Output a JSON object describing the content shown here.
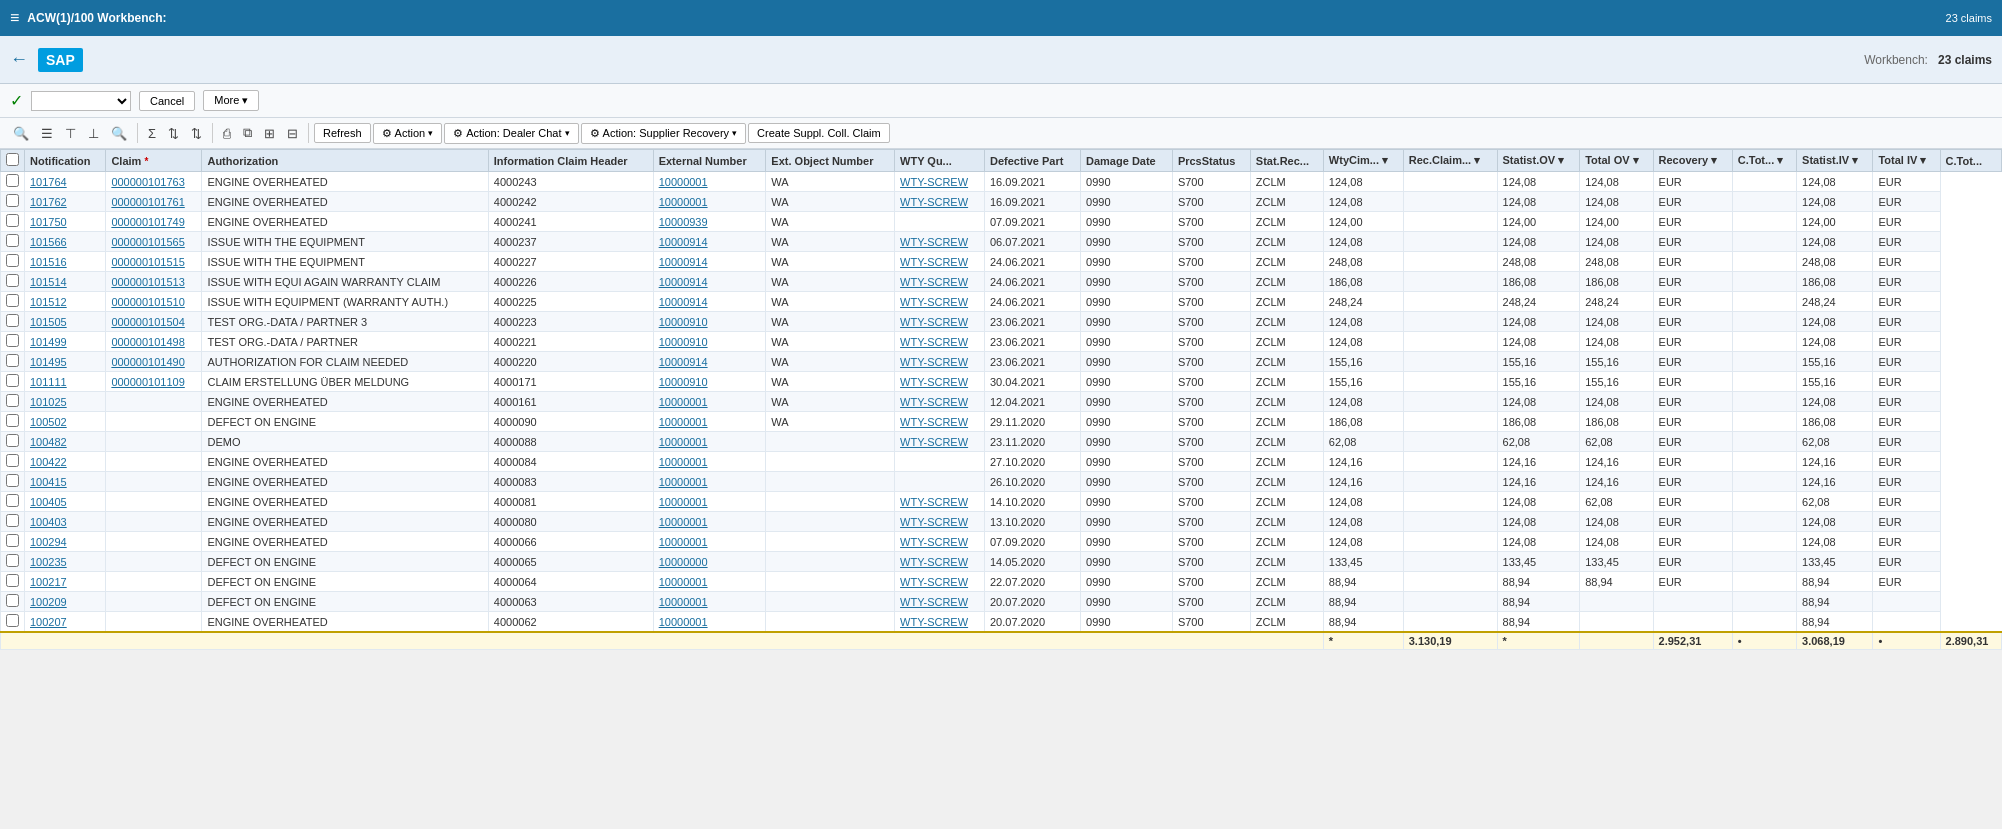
{
  "topbar": {
    "menu_icon": "≡",
    "title": "ACW(1)/100 Workbench:",
    "claims_label": "23 claims"
  },
  "header": {
    "back_label": "←",
    "logo_text": "SAP",
    "workbench_label": "Workbench:",
    "claims_count": "23 claims"
  },
  "actionbar": {
    "check_icon": "✓",
    "cancel_label": "Cancel",
    "more_label": "More ▾"
  },
  "toolbar": {
    "search_icon": "🔍",
    "filter_icons": [
      "☰",
      "⊤",
      "⊥"
    ],
    "sum_icon": "Σ",
    "sort_icon": "⇅",
    "print_icon": "⎙",
    "copy_icon": "⧉",
    "export_icon": "⊞",
    "refresh_label": "Refresh",
    "action_label": "Action",
    "action_dealer_label": "Action: Dealer Chat",
    "action_supplier_label": "Action: Supplier Recovery",
    "create_label": "Create Suppl. Coll. Claim"
  },
  "table": {
    "columns": [
      "",
      "Notification",
      "Claim",
      "Authorization",
      "Information Claim Header",
      "External Number",
      "Ext. Object Number",
      "WTY Qu...",
      "Defective Part",
      "Damage Date",
      "PrcsStatus",
      "Stat.Rec...",
      "WtyCim... ▾",
      "Rec.Claim... ▾",
      "Statist.OV ▾",
      "Total OV ▾",
      "Recovery ▾",
      "C.Tot... ▾",
      "Statist.IV ▾",
      "Total IV ▾",
      "C.Tot..."
    ],
    "rows": [
      [
        "",
        "101764",
        "000000101763",
        "ENGINE OVERHEATED",
        "4000243",
        "10000001",
        "WA",
        "WTY-SCREW",
        "16.09.2021",
        "0990",
        "S700",
        "ZCLM",
        "124,08",
        "",
        "124,08",
        "124,08",
        "EUR",
        "",
        "124,08",
        "EUR"
      ],
      [
        "",
        "101762",
        "000000101761",
        "ENGINE OVERHEATED",
        "4000242",
        "10000001",
        "WA",
        "WTY-SCREW",
        "16.09.2021",
        "0990",
        "S700",
        "ZCLM",
        "124,08",
        "",
        "124,08",
        "124,08",
        "EUR",
        "",
        "124,08",
        "EUR"
      ],
      [
        "",
        "101750",
        "000000101749",
        "ENGINE OVERHEATED",
        "4000241",
        "10000939",
        "WA",
        "",
        "07.09.2021",
        "0990",
        "S700",
        "ZCLM",
        "124,00",
        "",
        "124,00",
        "124,00",
        "EUR",
        "",
        "124,00",
        "EUR"
      ],
      [
        "",
        "101566",
        "000000101565",
        "ISSUE WITH THE EQUIPMENT",
        "4000237",
        "10000914",
        "WA",
        "WTY-SCREW",
        "06.07.2021",
        "0990",
        "S700",
        "ZCLM",
        "124,08",
        "",
        "124,08",
        "124,08",
        "EUR",
        "",
        "124,08",
        "EUR"
      ],
      [
        "",
        "101516",
        "000000101515",
        "ISSUE WITH THE EQUIPMENT",
        "4000227",
        "10000914",
        "WA",
        "WTY-SCREW",
        "24.06.2021",
        "0990",
        "S700",
        "ZCLM",
        "248,08",
        "",
        "248,08",
        "248,08",
        "EUR",
        "",
        "248,08",
        "EUR"
      ],
      [
        "",
        "101514",
        "000000101513",
        "ISSUE WITH EQUI AGAIN WARRANTY CLAIM",
        "4000226",
        "10000914",
        "WA",
        "WTY-SCREW",
        "24.06.2021",
        "0990",
        "S700",
        "ZCLM",
        "186,08",
        "",
        "186,08",
        "186,08",
        "EUR",
        "",
        "186,08",
        "EUR"
      ],
      [
        "",
        "101512",
        "000000101510",
        "ISSUE WITH EQUIPMENT (WARRANTY AUTH.)",
        "4000225",
        "10000914",
        "WA",
        "WTY-SCREW",
        "24.06.2021",
        "0990",
        "S700",
        "ZCLM",
        "248,24",
        "",
        "248,24",
        "248,24",
        "EUR",
        "",
        "248,24",
        "EUR"
      ],
      [
        "",
        "101505",
        "000000101504",
        "TEST ORG.-DATA / PARTNER 3",
        "4000223",
        "10000910",
        "WA",
        "WTY-SCREW",
        "23.06.2021",
        "0990",
        "S700",
        "ZCLM",
        "124,08",
        "",
        "124,08",
        "124,08",
        "EUR",
        "",
        "124,08",
        "EUR"
      ],
      [
        "",
        "101499",
        "000000101498",
        "TEST ORG.-DATA / PARTNER",
        "4000221",
        "10000910",
        "WA",
        "WTY-SCREW",
        "23.06.2021",
        "0990",
        "S700",
        "ZCLM",
        "124,08",
        "",
        "124,08",
        "124,08",
        "EUR",
        "",
        "124,08",
        "EUR"
      ],
      [
        "",
        "101495",
        "000000101490",
        "AUTHORIZATION FOR CLAIM NEEDED",
        "4000220",
        "10000914",
        "WA",
        "WTY-SCREW",
        "23.06.2021",
        "0990",
        "S700",
        "ZCLM",
        "155,16",
        "",
        "155,16",
        "155,16",
        "EUR",
        "",
        "155,16",
        "EUR"
      ],
      [
        "",
        "101111",
        "000000101109",
        "CLAIM ERSTELLUNG ÜBER MELDUNG",
        "4000171",
        "10000910",
        "WA",
        "WTY-SCREW",
        "30.04.2021",
        "0990",
        "S700",
        "ZCLM",
        "155,16",
        "",
        "155,16",
        "155,16",
        "EUR",
        "",
        "155,16",
        "EUR"
      ],
      [
        "",
        "101025",
        "",
        "ENGINE OVERHEATED",
        "4000161",
        "10000001",
        "WA",
        "WTY-SCREW",
        "12.04.2021",
        "0990",
        "S700",
        "ZCLM",
        "124,08",
        "",
        "124,08",
        "124,08",
        "EUR",
        "",
        "124,08",
        "EUR"
      ],
      [
        "",
        "100502",
        "",
        "DEFECT ON ENGINE",
        "4000090",
        "10000001",
        "WA",
        "WTY-SCREW",
        "29.11.2020",
        "0990",
        "S700",
        "ZCLM",
        "186,08",
        "",
        "186,08",
        "186,08",
        "EUR",
        "",
        "186,08",
        "EUR"
      ],
      [
        "",
        "100482",
        "",
        "DEMO",
        "4000088",
        "10000001",
        "",
        "WTY-SCREW",
        "23.11.2020",
        "0990",
        "S700",
        "ZCLM",
        "62,08",
        "",
        "62,08",
        "62,08",
        "EUR",
        "",
        "62,08",
        "EUR"
      ],
      [
        "",
        "100422",
        "",
        "ENGINE OVERHEATED",
        "4000084",
        "10000001",
        "",
        "",
        "27.10.2020",
        "0990",
        "S700",
        "ZCLM",
        "124,16",
        "",
        "124,16",
        "124,16",
        "EUR",
        "",
        "124,16",
        "EUR"
      ],
      [
        "",
        "100415",
        "",
        "ENGINE OVERHEATED",
        "4000083",
        "10000001",
        "",
        "",
        "26.10.2020",
        "0990",
        "S700",
        "ZCLM",
        "124,16",
        "",
        "124,16",
        "124,16",
        "EUR",
        "",
        "124,16",
        "EUR"
      ],
      [
        "",
        "100405",
        "",
        "ENGINE OVERHEATED",
        "4000081",
        "10000001",
        "",
        "WTY-SCREW",
        "14.10.2020",
        "0990",
        "S700",
        "ZCLM",
        "124,08",
        "",
        "124,08",
        "62,08",
        "EUR",
        "",
        "62,08",
        "EUR"
      ],
      [
        "",
        "100403",
        "",
        "ENGINE OVERHEATED",
        "4000080",
        "10000001",
        "",
        "WTY-SCREW",
        "13.10.2020",
        "0990",
        "S700",
        "ZCLM",
        "124,08",
        "",
        "124,08",
        "124,08",
        "EUR",
        "",
        "124,08",
        "EUR"
      ],
      [
        "",
        "100294",
        "",
        "ENGINE OVERHEATED",
        "4000066",
        "10000001",
        "",
        "WTY-SCREW",
        "07.09.2020",
        "0990",
        "S700",
        "ZCLM",
        "124,08",
        "",
        "124,08",
        "124,08",
        "EUR",
        "",
        "124,08",
        "EUR"
      ],
      [
        "",
        "100235",
        "",
        "DEFECT ON ENGINE",
        "4000065",
        "10000000",
        "",
        "WTY-SCREW",
        "14.05.2020",
        "0990",
        "S700",
        "ZCLM",
        "133,45",
        "",
        "133,45",
        "133,45",
        "EUR",
        "",
        "133,45",
        "EUR"
      ],
      [
        "",
        "100217",
        "",
        "DEFECT ON ENGINE",
        "4000064",
        "10000001",
        "",
        "WTY-SCREW",
        "22.07.2020",
        "0990",
        "S700",
        "ZCLM",
        "88,94",
        "",
        "88,94",
        "88,94",
        "EUR",
        "",
        "88,94",
        "EUR"
      ],
      [
        "",
        "100209",
        "",
        "DEFECT ON ENGINE",
        "4000063",
        "10000001",
        "",
        "WTY-SCREW",
        "20.07.2020",
        "0990",
        "S700",
        "ZCLM",
        "88,94",
        "",
        "88,94",
        "",
        "",
        "",
        "88,94",
        ""
      ],
      [
        "",
        "100207",
        "",
        "ENGINE OVERHEATED",
        "4000062",
        "10000001",
        "",
        "WTY-SCREW",
        "20.07.2020",
        "0990",
        "S700",
        "ZCLM",
        "88,94",
        "",
        "88,94",
        "",
        "",
        "",
        "88,94",
        ""
      ]
    ],
    "footer": {
      "total_label": "*",
      "total_1": "3.130,19",
      "total_2": "*",
      "total_3": "2.952,31",
      "total_4": "•",
      "total_5": "3.068,19",
      "total_6": "•",
      "total_7": "2.890,31"
    }
  }
}
